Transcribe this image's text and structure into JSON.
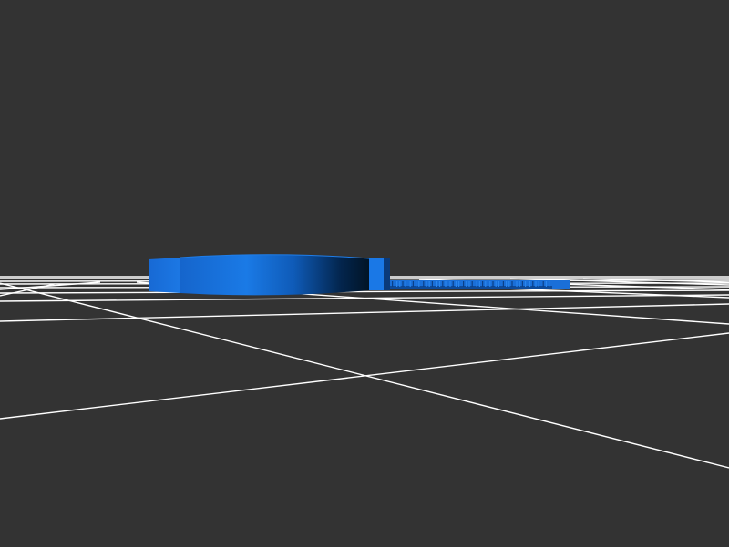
{
  "viewport": {
    "background": "#333333",
    "grid_color": "#ffffff",
    "model_color": "#1a73e0",
    "model_shadow": "#001830"
  },
  "model": {
    "part_names": [
      "disc-body",
      "disc-tab",
      "comb-strip"
    ]
  }
}
